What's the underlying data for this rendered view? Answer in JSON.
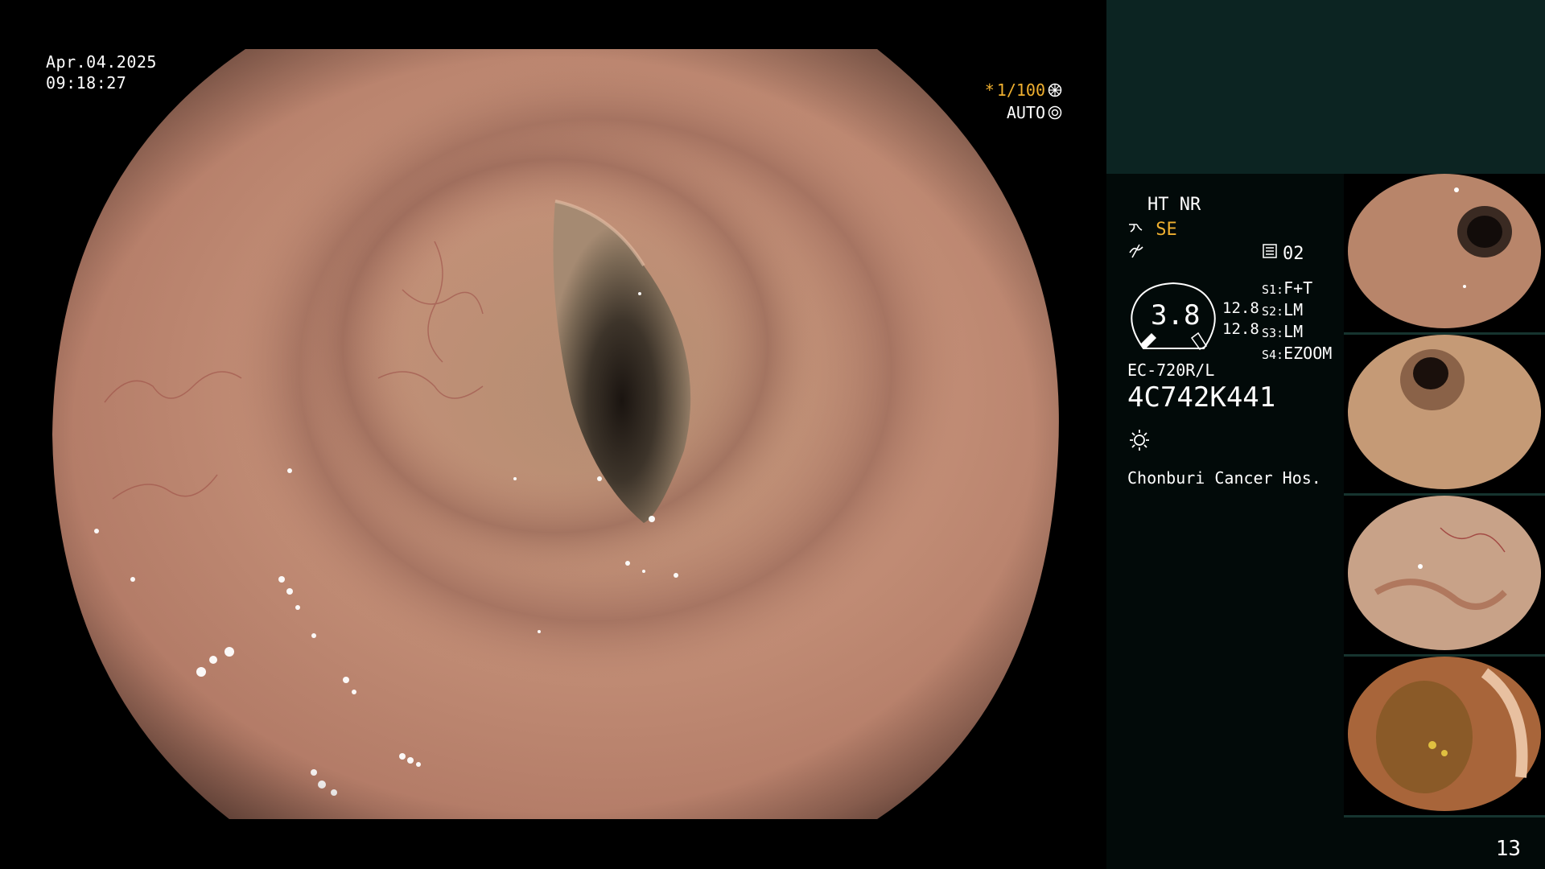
{
  "overlay": {
    "date": "Apr.04.2025",
    "time": "09:18:27",
    "shutter": "1/100",
    "shutter_mark": "*",
    "mode": "AUTO"
  },
  "panel": {
    "structure_enhance": "HT NR",
    "enhance_mode": "SE",
    "memory_channel": "02",
    "zoom_value": "3.8",
    "value_a": "12.8",
    "value_b": "12.8",
    "switches": [
      {
        "key": "S1:",
        "value": "F+T"
      },
      {
        "key": "S2:",
        "value": "LM"
      },
      {
        "key": "S3:",
        "value": "LM"
      },
      {
        "key": "S4:",
        "value": "EZOOM"
      }
    ],
    "scope_model": "EC-720R/L",
    "scope_serial": "4C742K441",
    "hospital": "Chonburi Cancer Hos.",
    "page_number": "13"
  },
  "thumbnails": [
    {
      "name": "capture-1"
    },
    {
      "name": "capture-2"
    },
    {
      "name": "capture-3"
    },
    {
      "name": "capture-4"
    }
  ],
  "colors": {
    "panel_top": "#0c2422",
    "panel_bg": "#020a09",
    "accent": "#f0b030"
  }
}
